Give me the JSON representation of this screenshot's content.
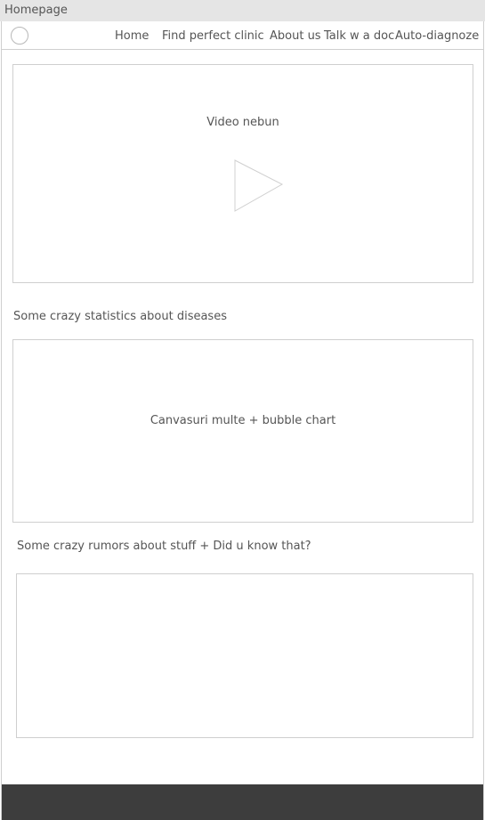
{
  "window": {
    "title": "Homepage"
  },
  "nav": {
    "items": [
      {
        "label": "Home"
      },
      {
        "label": "Find perfect clinic"
      },
      {
        "label": "About us"
      },
      {
        "label": "Talk w a doc"
      },
      {
        "label": "Auto-diagnoze"
      }
    ]
  },
  "video": {
    "label": "Video nebun",
    "icon": "play-icon"
  },
  "stats": {
    "title": "Some crazy statistics about diseases",
    "chart_label": "Canvasuri multe + bubble chart"
  },
  "rumors": {
    "title": "Some crazy rumors about stuff + Did u know that?"
  }
}
